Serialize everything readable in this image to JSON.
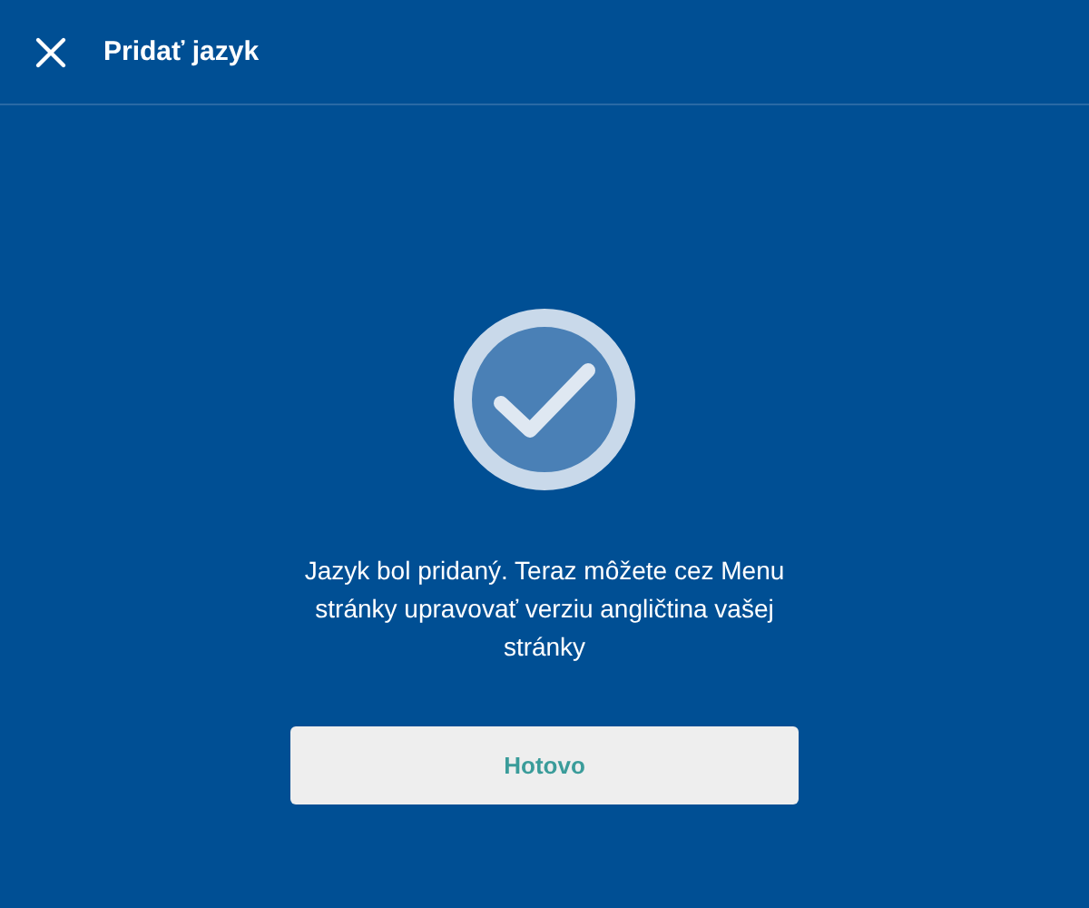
{
  "header": {
    "title": "Pridať jazyk"
  },
  "message": "Jazyk bol pridaný. Teraz môžete cez Menu stránky upravovať verziu angličtina vašej stránky",
  "buttons": [
    {
      "label": "Hotovo"
    }
  ]
}
